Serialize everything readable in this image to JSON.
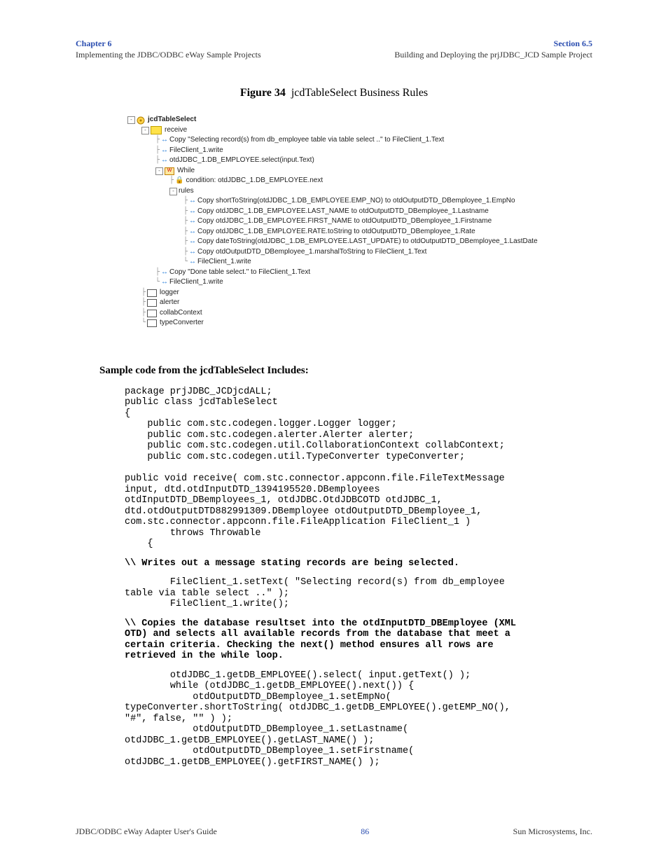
{
  "header": {
    "chapter": "Chapter 6",
    "chapter_sub": "Implementing the JDBC/ODBC eWay Sample Projects",
    "section": "Section 6.5",
    "section_sub": "Building and Deploying the prjJDBC_JCD Sample Project"
  },
  "figure": {
    "label": "Figure 34",
    "title": "jcdTableSelect Business Rules"
  },
  "tree": {
    "root": "jcdTableSelect",
    "receive": "receive",
    "lines": [
      "Copy \"Selecting record(s) from db_employee table via table select ..\" to FileClient_1.Text",
      "FileClient_1.write",
      "otdJDBC_1.DB_EMPLOYEE.select(input.Text)"
    ],
    "while_label": "While",
    "condition": "condition: otdJDBC_1.DB_EMPLOYEE.next",
    "rules_label": "rules",
    "rules": [
      "Copy shortToString(otdJDBC_1.DB_EMPLOYEE.EMP_NO) to otdOutputDTD_DBemployee_1.EmpNo",
      "Copy otdJDBC_1.DB_EMPLOYEE.LAST_NAME to otdOutputDTD_DBemployee_1.Lastname",
      "Copy otdJDBC_1.DB_EMPLOYEE.FIRST_NAME to otdOutputDTD_DBemployee_1.Firstname",
      "Copy otdJDBC_1.DB_EMPLOYEE.RATE.toString to otdOutputDTD_DBemployee_1.Rate",
      "Copy dateToString(otdJDBC_1.DB_EMPLOYEE.LAST_UPDATE) to otdOutputDTD_DBemployee_1.LastDate",
      "Copy otdOutputDTD_DBemployee_1.marshalToString to FileClient_1.Text",
      "FileClient_1.write"
    ],
    "post": [
      "Copy \"Done table select.\" to FileClient_1.Text",
      "FileClient_1.write"
    ],
    "vars": [
      "logger",
      "alerter",
      "collabContext",
      "typeConverter"
    ]
  },
  "sample_heading": "Sample code from the jcdTableSelect Includes:",
  "code": {
    "block1": "package prjJDBC_JCDjcdALL;\npublic class jcdTableSelect\n{\n    public com.stc.codegen.logger.Logger logger;\n    public com.stc.codegen.alerter.Alerter alerter;\n    public com.stc.codegen.util.CollaborationContext collabContext;\n    public com.stc.codegen.util.TypeConverter typeConverter;\n\npublic void receive( com.stc.connector.appconn.file.FileTextMessage \ninput, dtd.otdInputDTD_1394195520.DBemployees \notdInputDTD_DBemployees_1, otdJDBC.OtdJDBCOTD otdJDBC_1, \ndtd.otdOutputDTD882991309.DBemployee otdOutputDTD_DBemployee_1, \ncom.stc.connector.appconn.file.FileApplication FileClient_1 )\n        throws Throwable\n    {",
    "comment1": "\\\\ Writes out a message stating records are being selected.",
    "block2": "        FileClient_1.setText( \"Selecting record(s) from db_employee \ntable via table select ..\" );\n        FileClient_1.write();",
    "comment2": "\\\\ Copies the database resultset into the otdInputDTD_DBEmployee (XML \nOTD) and selects all available records from the database that meet a \ncertain criteria. Checking the next() method ensures all rows are \nretrieved in the while loop.",
    "block3": "        otdJDBC_1.getDB_EMPLOYEE().select( input.getText() );\n        while (otdJDBC_1.getDB_EMPLOYEE().next()) {\n            otdOutputDTD_DBemployee_1.setEmpNo( \ntypeConverter.shortToString( otdJDBC_1.getDB_EMPLOYEE().getEMP_NO(), \n\"#\", false, \"\" ) );\n            otdOutputDTD_DBemployee_1.setLastname( \notdJDBC_1.getDB_EMPLOYEE().getLAST_NAME() );\n            otdOutputDTD_DBemployee_1.setFirstname( \notdJDBC_1.getDB_EMPLOYEE().getFIRST_NAME() );"
  },
  "footer": {
    "left": "JDBC/ODBC eWay Adapter User's Guide",
    "page": "86",
    "right": "Sun Microsystems, Inc."
  }
}
